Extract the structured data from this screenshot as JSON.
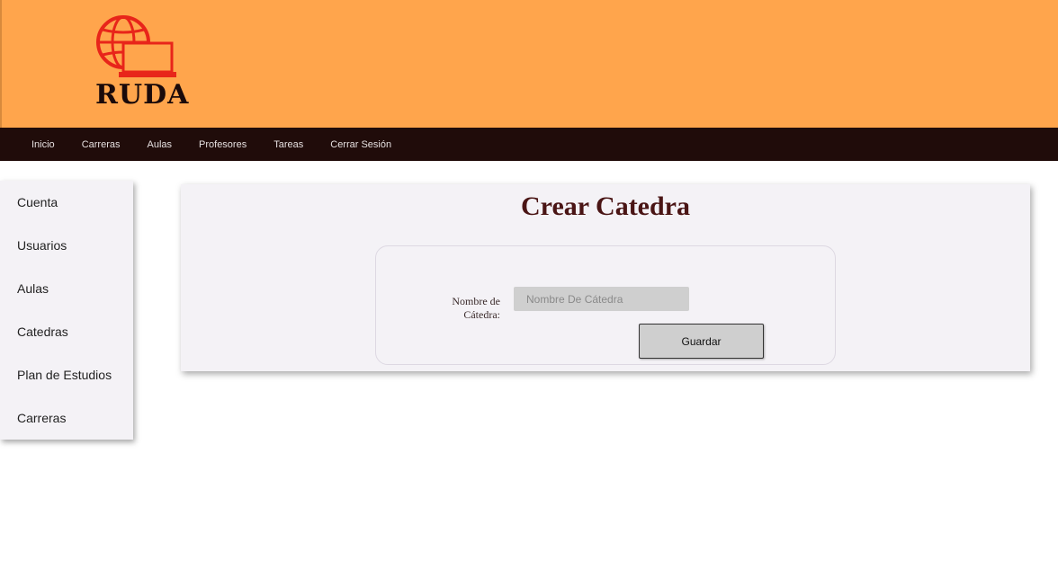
{
  "header": {
    "logo_text": "RUDA",
    "background_color": "#ffa54c"
  },
  "nav": {
    "items": [
      "Inicio",
      "Carreras",
      "Aulas",
      "Profesores",
      "Tareas",
      "Cerrar Sesión"
    ],
    "background_color": "#200c0a"
  },
  "sidebar": {
    "items": [
      "Cuenta",
      "Usuarios",
      "Aulas",
      "Catedras",
      "Plan de Estudios",
      "Carreras"
    ]
  },
  "main": {
    "title": "Crear Catedra",
    "form": {
      "field_label": "Nombre de Cátedra:",
      "field_placeholder": "Nombre De Cátedra",
      "field_value": "",
      "submit_label": "Guardar"
    }
  }
}
